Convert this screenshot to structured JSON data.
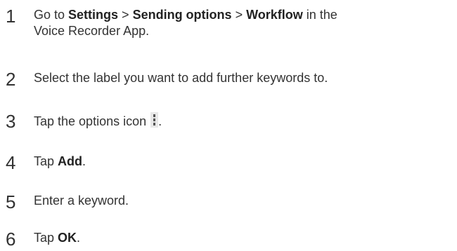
{
  "steps": [
    {
      "number": "1",
      "line1": [
        {
          "text": "Go to ",
          "bold": false
        },
        {
          "text": "Settings",
          "bold": true
        },
        {
          "text": " > ",
          "bold": false
        },
        {
          "text": "Sending options",
          "bold": true
        },
        {
          "text": " > ",
          "bold": false
        },
        {
          "text": "Workflow",
          "bold": true
        },
        {
          "text": " in the",
          "bold": false
        }
      ],
      "line2": "Voice Recorder App."
    },
    {
      "number": "2",
      "pre": "Select the label you want to add further keywords to."
    },
    {
      "number": "3",
      "pre": "Tap the options icon",
      "icon": "vertical-dots-menu-icon",
      "post": "."
    },
    {
      "number": "4",
      "pre": "Tap ",
      "bold": "Add",
      "post": "."
    },
    {
      "number": "5",
      "pre": "Enter a keyword."
    },
    {
      "number": "6",
      "pre": "Tap ",
      "bold": "OK",
      "post": "."
    }
  ]
}
